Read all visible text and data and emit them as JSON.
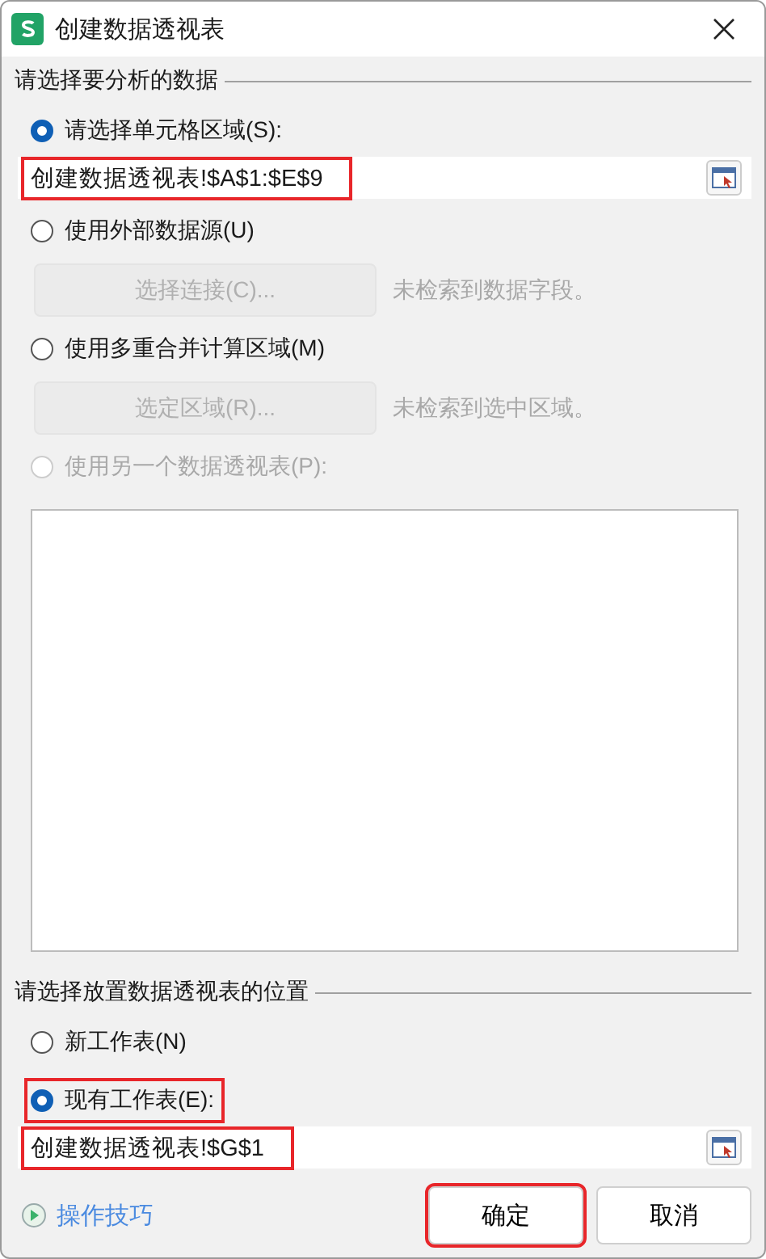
{
  "window": {
    "title": "创建数据透视表"
  },
  "source": {
    "heading": "请选择要分析的数据",
    "options": [
      {
        "kind": "range",
        "label": "请选择单元格区域(S):",
        "selected": true,
        "disabled": false,
        "highlighted": false,
        "field": {
          "value": "创建数据透视表!$A$1:$E$9",
          "highlighted": true
        }
      },
      {
        "kind": "connect",
        "label": "使用外部数据源(U)",
        "selected": false,
        "disabled": false,
        "button": {
          "label": "选择连接(C)...",
          "disabled": true
        },
        "note": "未检索到数据字段。"
      },
      {
        "kind": "connect",
        "label": "使用多重合并计算区域(M)",
        "selected": false,
        "disabled": false,
        "button": {
          "label": "选定区域(R)...",
          "disabled": true
        },
        "note": "未检索到选中区域。"
      },
      {
        "kind": "list",
        "label": "使用另一个数据透视表(P):",
        "selected": false,
        "disabled": true
      }
    ]
  },
  "destination": {
    "heading": "请选择放置数据透视表的位置",
    "options": [
      {
        "label": "新工作表(N)",
        "selected": false,
        "disabled": false,
        "highlighted": false
      },
      {
        "label": "现有工作表(E):",
        "selected": true,
        "disabled": false,
        "highlighted": true
      }
    ],
    "field": {
      "value": "创建数据透视表!$G$1",
      "highlighted": true
    }
  },
  "footer": {
    "tips": "操作技巧",
    "buttons": [
      {
        "label": "确定",
        "highlighted": true
      },
      {
        "label": "取消",
        "highlighted": false
      }
    ]
  }
}
